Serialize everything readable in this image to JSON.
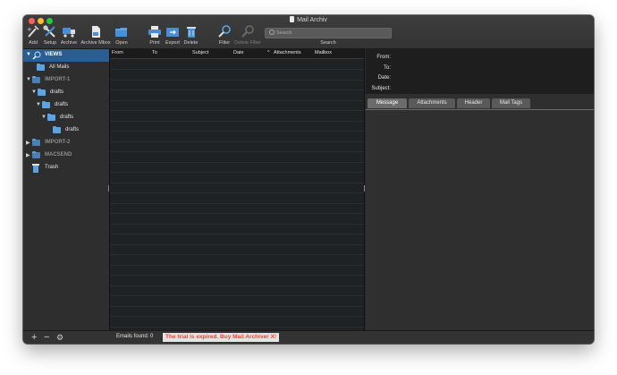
{
  "window": {
    "title": "Mail Archiv"
  },
  "toolbar": {
    "add": "Add",
    "setup": "Setup",
    "archive": "Archive",
    "archive_mbox": "Archive Mbox",
    "open": "Open",
    "print": "Print",
    "export": "Export",
    "delete": "Delete",
    "filter": "Filter",
    "delete_filter": "Delete Filter"
  },
  "search": {
    "placeholder": "Search",
    "label": "Search"
  },
  "sidebar": {
    "items": [
      {
        "label": "VIEWS"
      },
      {
        "label": "All Mails"
      },
      {
        "label": "IMPORT-1"
      },
      {
        "label": "drafts"
      },
      {
        "label": "drafts"
      },
      {
        "label": "drafts"
      },
      {
        "label": "drafts"
      },
      {
        "label": "IMPORT-2"
      },
      {
        "label": "MACSEND"
      },
      {
        "label": "Trash"
      }
    ]
  },
  "list": {
    "columns": [
      "From",
      "To",
      "Subject",
      "Date",
      "Attachments",
      "Mailbox"
    ],
    "sort_indicator": "^"
  },
  "preview": {
    "labels": {
      "from": "From:",
      "to": "To:",
      "date": "Date:",
      "subject": "Subject:"
    },
    "tabs": [
      "Message",
      "Attachments",
      "Header",
      "Mail Tags"
    ]
  },
  "status": {
    "emails_found": "Emails found: 0",
    "trial": "The trial is expired. Buy Mail Archiver X!"
  }
}
